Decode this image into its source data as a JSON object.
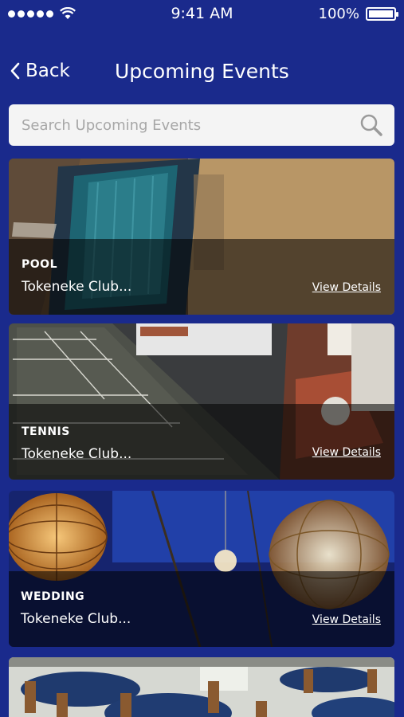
{
  "status": {
    "time": "9:41 AM",
    "battery": "100%",
    "battery_level": 1.0
  },
  "nav": {
    "back_label": "Back",
    "title": "Upcoming Events"
  },
  "search": {
    "placeholder": "Search Upcoming Events",
    "value": ""
  },
  "events": [
    {
      "category": "POOL",
      "club": "Tokeneke Club...",
      "link": "View Details"
    },
    {
      "category": "TENNIS",
      "club": "Tokeneke Club...",
      "link": "View Details"
    },
    {
      "category": "WEDDING",
      "club": "Tokeneke Club...",
      "link": "View Details"
    }
  ],
  "colors": {
    "background": "#1a2a8c",
    "search_bg": "#f4f4f4"
  }
}
